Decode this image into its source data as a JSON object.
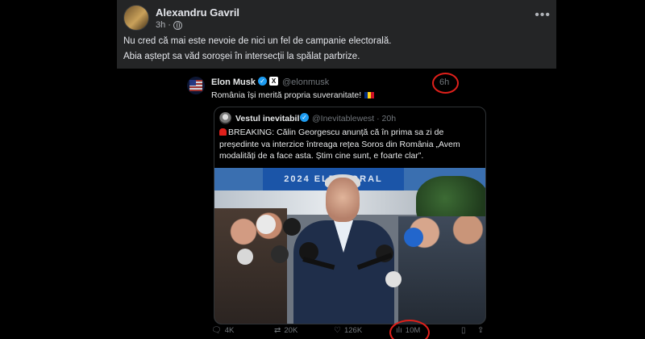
{
  "post": {
    "author": "Alexandru Gavril",
    "time": "3h",
    "visibility_sep": "·",
    "lines": [
      "Nu cred că mai este nevoie de nici un fel de campanie electorală.",
      "Abia aștept sa văd soroșei în intersecții la spălat parbrize."
    ]
  },
  "tweet": {
    "name": "Elon Musk",
    "handle": "@elonmusk",
    "time": "6h",
    "text": "România își merită propria suveranitate!",
    "quote": {
      "name": "Vestul inevitabil",
      "handle": "@Inevitablewest · 20h",
      "text": "BREAKING: Călin Georgescu anunță că în prima sa zi de președinte va interzice întreaga rețea Soros din România „Avem modalități de a face asta. Știm cine sunt, e foarte clar”.",
      "photo_sign": "2024 ELECTORAL"
    },
    "actions": {
      "replies": "4K",
      "reposts": "20K",
      "likes": "126K",
      "views": "10M"
    }
  },
  "colors": {
    "highlight_circle": "#e0201b",
    "verified": "#1d9bf0"
  },
  "icons": [
    "globe-icon",
    "more-icon",
    "verified-icon",
    "x-badge-icon",
    "grok-icon",
    "siren-icon",
    "reply-icon",
    "repost-icon",
    "like-icon",
    "views-icon",
    "bookmark-icon",
    "share-icon"
  ]
}
